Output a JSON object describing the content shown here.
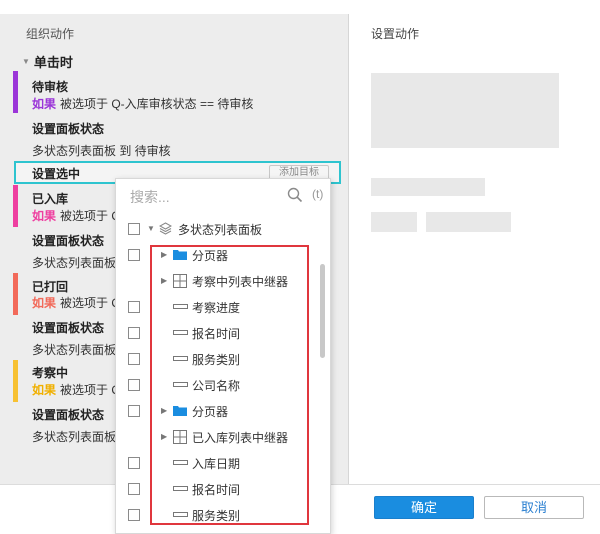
{
  "left": {
    "header": "组织动作",
    "trigger": "单击时",
    "blocks": [
      {
        "color": "#9b35d8",
        "title": "待审核",
        "kw": "如果",
        "kw_color": "#9b35d8",
        "cond": "被选项于 Q-入库审核状态 == 待审核",
        "action": "设置面板状态",
        "detail": "多状态列表面板 到 待审核"
      },
      {
        "color": "#ee3fa0",
        "title": "已入库",
        "kw": "如果",
        "kw_color": "#ee3fa0",
        "cond": "被选项于 Q",
        "action": "设置面板状态",
        "detail": "多状态列表面板"
      },
      {
        "color": "#f26a5a",
        "title": "已打回",
        "kw": "如果",
        "kw_color": "#f26a5a",
        "cond": "被选项于 Q",
        "action": "设置面板状态",
        "detail": "多状态列表面板"
      },
      {
        "color": "#f7c132",
        "title": "考察中",
        "kw": "如果",
        "kw_color": "#f0b000",
        "cond": "被选项于 Q",
        "action": "设置面板状态",
        "detail": "多状态列表面板"
      }
    ],
    "selected_label": "设置选中",
    "add_target": "添加目标"
  },
  "right": {
    "header": "设置动作"
  },
  "buttons": {
    "ok": "确定",
    "cancel": "取消"
  },
  "dropdown": {
    "search_placeholder": "搜索...",
    "paren": "(t)",
    "root": "多状态列表面板",
    "items": [
      {
        "label": "分页器",
        "icon": "folder-icon",
        "caret": true,
        "checkbox": true
      },
      {
        "label": "考察中列表中继器",
        "icon": "repeater-icon",
        "caret": true,
        "checkbox": false
      },
      {
        "label": "考察进度",
        "icon": "field-icon",
        "caret": false,
        "checkbox": true
      },
      {
        "label": "报名时间",
        "icon": "field-icon",
        "caret": false,
        "checkbox": true
      },
      {
        "label": "服务类别",
        "icon": "field-icon",
        "caret": false,
        "checkbox": true
      },
      {
        "label": "公司名称",
        "icon": "field-icon",
        "caret": false,
        "checkbox": true
      },
      {
        "label": "分页器",
        "icon": "folder-icon",
        "caret": true,
        "checkbox": true
      },
      {
        "label": "已入库列表中继器",
        "icon": "repeater-icon",
        "caret": true,
        "checkbox": false
      },
      {
        "label": "入库日期",
        "icon": "field-icon",
        "caret": false,
        "checkbox": true
      },
      {
        "label": "报名时间",
        "icon": "field-icon",
        "caret": false,
        "checkbox": true
      },
      {
        "label": "服务类别",
        "icon": "field-icon",
        "caret": false,
        "checkbox": true
      }
    ]
  }
}
